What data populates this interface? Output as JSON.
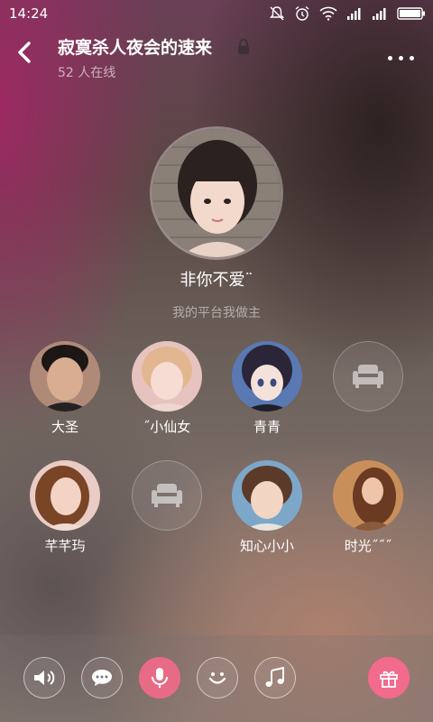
{
  "status": {
    "time": "14:24"
  },
  "room": {
    "title": "寂寞杀人夜会的速来",
    "online": "52 人在线"
  },
  "host": {
    "name": "非你不爱¨",
    "description": "我的平台我做主"
  },
  "seats": [
    {
      "name": "大圣",
      "occupied": true
    },
    {
      "name": "˝小仙女",
      "occupied": true
    },
    {
      "name": "青青",
      "occupied": true
    },
    {
      "name": "",
      "occupied": false
    },
    {
      "name": "芊芊玙",
      "occupied": true
    },
    {
      "name": "",
      "occupied": false
    },
    {
      "name": "知心小小",
      "occupied": true
    },
    {
      "name": "时光˝˝˝",
      "occupied": true
    }
  ],
  "controls": [
    "speaker-icon",
    "chat-icon",
    "microphone-icon",
    "emoji-icon",
    "music-icon",
    "gift-icon"
  ],
  "colors": {
    "accent": "#e86b86",
    "gift": "#f26a8c"
  }
}
